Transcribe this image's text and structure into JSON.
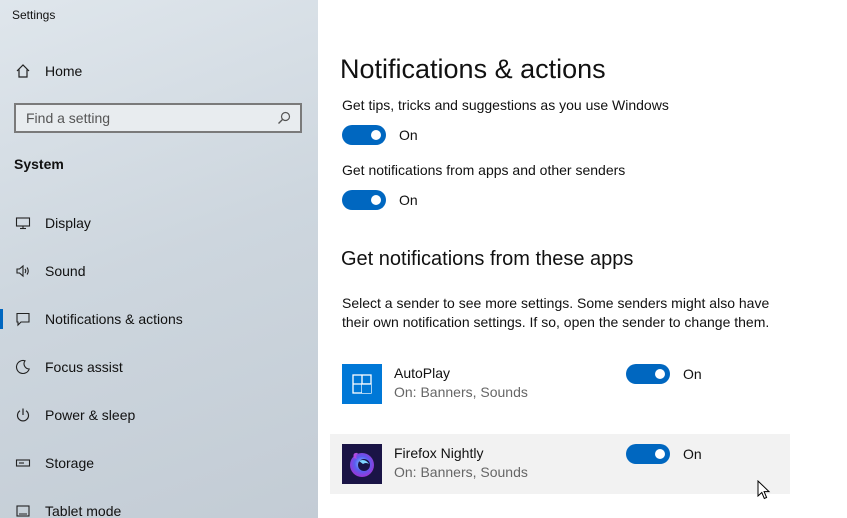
{
  "window": {
    "title": "Settings"
  },
  "sidebar": {
    "home_label": "Home",
    "search": {
      "placeholder": "Find a setting",
      "value": ""
    },
    "section_label": "System",
    "items": [
      {
        "label": "Display",
        "icon": "display-icon"
      },
      {
        "label": "Sound",
        "icon": "sound-icon"
      },
      {
        "label": "Notifications & actions",
        "icon": "notifications-icon",
        "selected": true
      },
      {
        "label": "Focus assist",
        "icon": "focus-assist-icon"
      },
      {
        "label": "Power & sleep",
        "icon": "power-icon"
      },
      {
        "label": "Storage",
        "icon": "storage-icon"
      },
      {
        "label": "Tablet mode",
        "icon": "tablet-icon"
      }
    ]
  },
  "main": {
    "title": "Notifications & actions",
    "settings": [
      {
        "label": "Get tips, tricks and suggestions as you use Windows",
        "state": "On"
      },
      {
        "label": "Get notifications from apps and other senders",
        "state": "On"
      }
    ],
    "apps_heading": "Get notifications from these apps",
    "apps_description": "Select a sender to see more settings. Some senders might also have their own notification settings. If so, open the sender to change them.",
    "apps": [
      {
        "name": "AutoPlay",
        "subtitle": "On: Banners, Sounds",
        "state": "On",
        "icon": "autoplay-icon"
      },
      {
        "name": "Firefox Nightly",
        "subtitle": "On: Banners, Sounds",
        "state": "On",
        "icon": "firefox-nightly-icon"
      }
    ]
  },
  "colors": {
    "accent": "#0067c0",
    "autoplay_tile": "#0078d7",
    "sidebar_bg": "#cdd6de"
  }
}
